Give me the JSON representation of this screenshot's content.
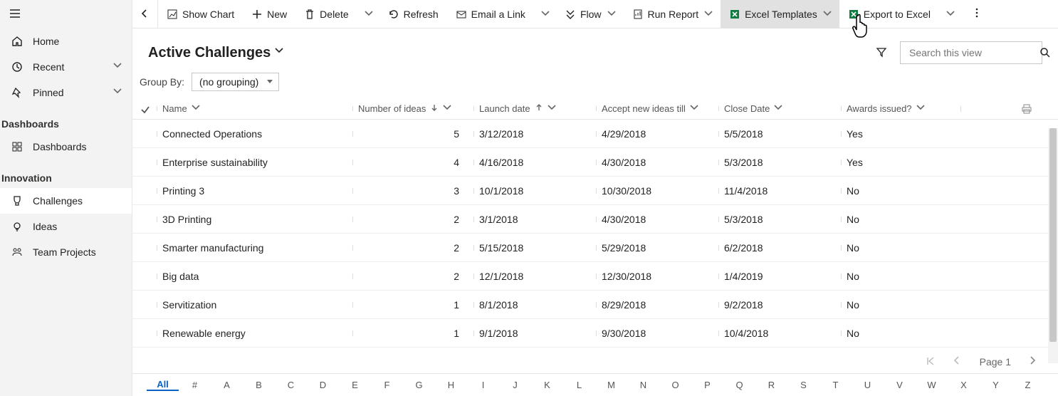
{
  "nav": {
    "main": [
      {
        "icon": "home",
        "label": "Home",
        "expandable": false
      },
      {
        "icon": "clock",
        "label": "Recent",
        "expandable": true
      },
      {
        "icon": "pin",
        "label": "Pinned",
        "expandable": true
      }
    ],
    "groups": [
      {
        "title": "Dashboards",
        "items": [
          {
            "icon": "dashboards",
            "label": "Dashboards",
            "selected": false
          }
        ]
      },
      {
        "title": "Innovation",
        "items": [
          {
            "icon": "challenges",
            "label": "Challenges",
            "selected": true
          },
          {
            "icon": "idea",
            "label": "Ideas",
            "selected": false
          },
          {
            "icon": "team",
            "label": "Team Projects",
            "selected": false
          }
        ]
      }
    ]
  },
  "commands": [
    {
      "id": "show-chart",
      "label": "Show Chart",
      "icon": "chart",
      "dropdown": false
    },
    {
      "id": "new",
      "label": "New",
      "icon": "plus",
      "dropdown": false
    },
    {
      "id": "delete",
      "label": "Delete",
      "icon": "trash",
      "dropdown": true
    },
    {
      "id": "refresh",
      "label": "Refresh",
      "icon": "refresh",
      "dropdown": false
    },
    {
      "id": "email-link",
      "label": "Email a Link",
      "icon": "mail",
      "dropdown": true
    },
    {
      "id": "flow",
      "label": "Flow",
      "icon": "flow",
      "dropdown": true,
      "inline_dropdown": true
    },
    {
      "id": "run-report",
      "label": "Run Report",
      "icon": "report",
      "dropdown": true,
      "inline_dropdown": true
    },
    {
      "id": "excel-templates",
      "label": "Excel Templates",
      "icon": "excelT",
      "dropdown": true,
      "inline_dropdown": true,
      "highlight": true
    },
    {
      "id": "export-excel",
      "label": "Export to Excel",
      "icon": "excel",
      "dropdown": true
    }
  ],
  "view": {
    "title": "Active Challenges",
    "group_by_label": "Group By:",
    "group_by_value": "(no grouping)",
    "search_placeholder": "Search this view"
  },
  "columns": [
    {
      "key": "name",
      "label": "Name",
      "sort": null
    },
    {
      "key": "ideas",
      "label": "Number of ideas",
      "sort": "desc"
    },
    {
      "key": "launch",
      "label": "Launch date",
      "sort": "asc"
    },
    {
      "key": "accept",
      "label": "Accept new ideas till",
      "sort": null
    },
    {
      "key": "close",
      "label": "Close Date",
      "sort": null
    },
    {
      "key": "awards",
      "label": "Awards issued?",
      "sort": null
    }
  ],
  "rows": [
    {
      "name": "Connected Operations",
      "ideas": "5",
      "launch": "3/12/2018",
      "accept": "4/29/2018",
      "close": "5/5/2018",
      "awards": "Yes"
    },
    {
      "name": "Enterprise sustainability",
      "ideas": "4",
      "launch": "4/16/2018",
      "accept": "4/30/2018",
      "close": "5/3/2018",
      "awards": "Yes"
    },
    {
      "name": "Printing 3",
      "ideas": "3",
      "launch": "10/1/2018",
      "accept": "10/30/2018",
      "close": "11/4/2018",
      "awards": "No"
    },
    {
      "name": "3D Printing",
      "ideas": "2",
      "launch": "3/1/2018",
      "accept": "4/30/2018",
      "close": "5/3/2018",
      "awards": "No"
    },
    {
      "name": "Smarter manufacturing",
      "ideas": "2",
      "launch": "5/15/2018",
      "accept": "5/29/2018",
      "close": "6/2/2018",
      "awards": "No"
    },
    {
      "name": "Big data",
      "ideas": "2",
      "launch": "12/1/2018",
      "accept": "12/30/2018",
      "close": "1/4/2019",
      "awards": "No"
    },
    {
      "name": "Servitization",
      "ideas": "1",
      "launch": "8/1/2018",
      "accept": "8/29/2018",
      "close": "9/2/2018",
      "awards": "No"
    },
    {
      "name": "Renewable energy",
      "ideas": "1",
      "launch": "9/1/2018",
      "accept": "9/30/2018",
      "close": "10/4/2018",
      "awards": "No"
    }
  ],
  "pager": {
    "label": "Page 1"
  },
  "alpha": [
    "All",
    "#",
    "A",
    "B",
    "C",
    "D",
    "E",
    "F",
    "G",
    "H",
    "I",
    "J",
    "K",
    "L",
    "M",
    "N",
    "O",
    "P",
    "Q",
    "R",
    "S",
    "T",
    "U",
    "V",
    "W",
    "X",
    "Y",
    "Z"
  ],
  "alpha_selected": "All"
}
